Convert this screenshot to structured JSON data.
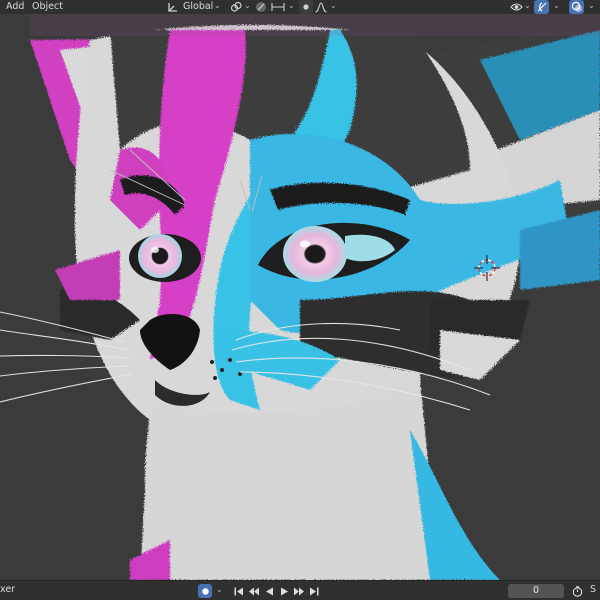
{
  "header": {
    "menu_add": "Add",
    "menu_object": "Object",
    "transform_orientation": "Global"
  },
  "timeline": {
    "editor_label": "xer",
    "current_frame": "0",
    "right_label": "S"
  },
  "icons": {
    "orientation": "transform-orientation-icon",
    "snap": "snap-icon",
    "proportional": "proportional-editing-icon",
    "visibility": "visibility-eye-icon",
    "gizmo": "gizmo-icon",
    "overlay": "overlay-icon",
    "record": "record-keyframe-icon",
    "jump_start": "jump-start-icon",
    "prev_key": "prev-keyframe-icon",
    "play_reverse": "play-reverse-icon",
    "play": "play-icon",
    "next_key": "next-keyframe-icon",
    "jump_end": "jump-end-icon"
  },
  "colors": {
    "header_bg": "#303030",
    "viewport_bg": "#3b3b3b",
    "accent": "#4772b3",
    "fur_cyan": "#36c4e6",
    "fur_magenta": "#d43fc5",
    "fur_white": "#d9d9d9",
    "fur_dark": "#3a3a3a"
  }
}
